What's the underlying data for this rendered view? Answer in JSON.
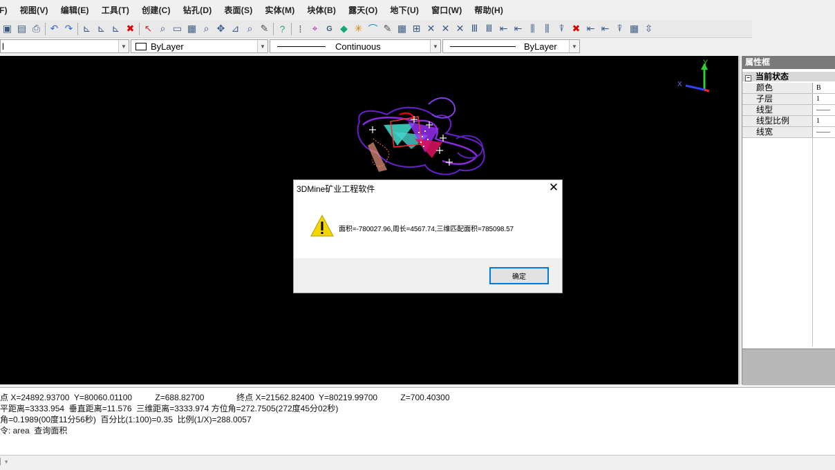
{
  "menu": [
    "F)",
    "视图(V)",
    "编辑(E)",
    "工具(T)",
    "创建(C)",
    "钻孔(D)",
    "表面(S)",
    "实体(M)",
    "块体(B)",
    "露天(O)",
    "地下(U)",
    "窗口(W)",
    "帮助(H)"
  ],
  "toolbar_icons": [
    "save-icon",
    "save-as-icon",
    "print-icon",
    "undo-icon",
    "redo-icon",
    "draw-icon",
    "draw-icon",
    "draw-icon",
    "delete-icon",
    "select-icon",
    "zoom-icon",
    "window-icon",
    "grid-icon",
    "zoom-icon",
    "pan-icon",
    "measure-icon",
    "zoom-icon",
    "pen-icon",
    "help-icon",
    "snap-icon",
    "target-icon",
    "gr-icon",
    "triangle-icon",
    "light-icon",
    "arc-icon",
    "pen-icon",
    "grid-icon",
    "table-icon",
    "cross-icon",
    "cross-icon",
    "cross-icon",
    "text-icon",
    "text-icon",
    "arrow-icon",
    "arrow-icon",
    "split-icon",
    "split-icon",
    "filter-icon",
    "delete-icon",
    "arrow-icon",
    "arrow-icon",
    "filter-icon",
    "grid-icon",
    "dimension-icon"
  ],
  "propbar": {
    "layer_value": "l",
    "color_value": "ByLayer",
    "linetype_value": "Continuous",
    "lineweight_value": "ByLayer"
  },
  "canvas": {
    "axis_y": "Y",
    "axis_x": "X"
  },
  "panel": {
    "title": "属性框",
    "section": "当前状态",
    "rows": [
      {
        "name": "颜色",
        "value": "B"
      },
      {
        "name": "子层",
        "value": "1"
      },
      {
        "name": "线型",
        "value": "——"
      },
      {
        "name": "线型比例",
        "value": "1"
      },
      {
        "name": "线宽",
        "value": "——"
      }
    ]
  },
  "command": {
    "lines": [
      "点 X=24892.93700  Y=80060.01100          Z=688.82700              终点 X=21562.82400  Y=80219.99700          Z=700.40300",
      "平距离=3333.954  垂直距离=11.576  三维距离=3333.974 方位角=272.7505(272度45分02秒)",
      "角=0.1989(00度11分56秒)  百分比(1:100)=0.35  比例(1/X)=288.0057",
      "令: area  查询面积"
    ]
  },
  "dialog": {
    "title": "3DMine矿业工程软件",
    "message": "面积=-780027.96,周长=4567.74,三维匹配面积=785098.57",
    "ok_label": "确定",
    "warning_color": "#f2d600"
  }
}
